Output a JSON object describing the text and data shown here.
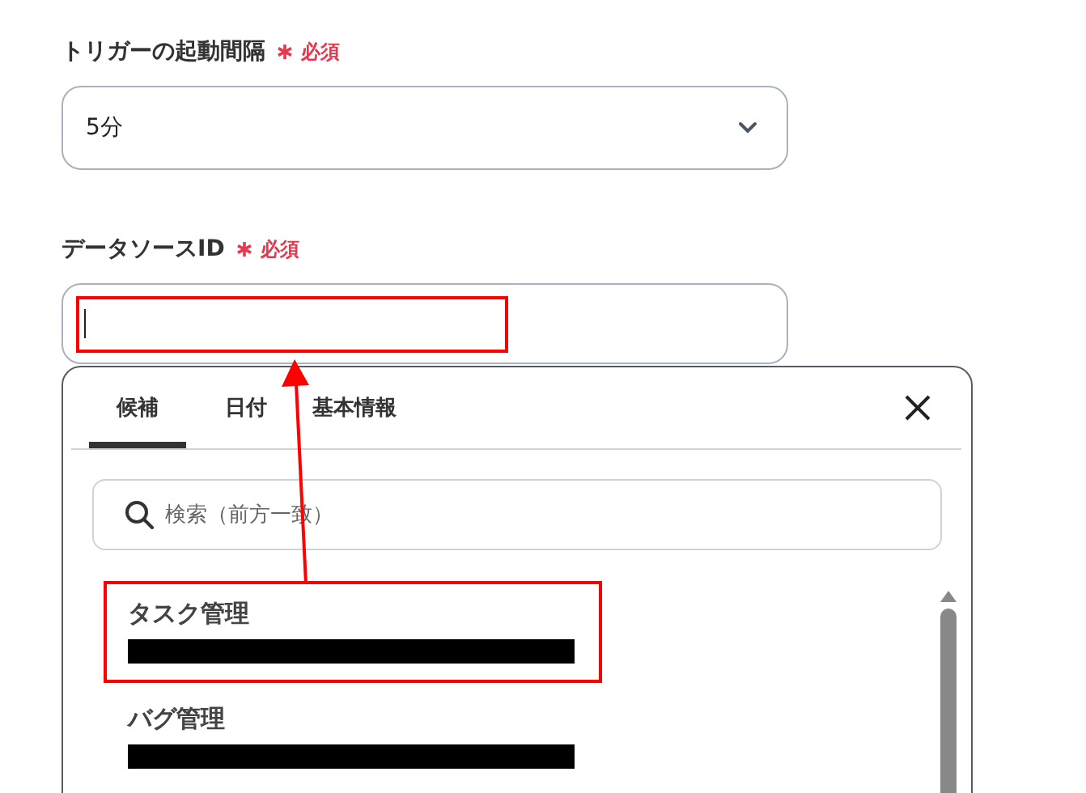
{
  "trigger_field": {
    "label": "トリガーの起動間隔",
    "required": "必須",
    "value": "5分"
  },
  "datasource_field": {
    "label": "データソースID",
    "required": "必須"
  },
  "popup": {
    "tabs": [
      {
        "label": "候補",
        "selected": true
      },
      {
        "label": "日付",
        "selected": false
      },
      {
        "label": "基本情報",
        "selected": false
      }
    ],
    "search": {
      "placeholder": "検索（前方一致）"
    },
    "items": [
      {
        "name": "タスク管理"
      },
      {
        "name": "バグ管理"
      }
    ]
  }
}
